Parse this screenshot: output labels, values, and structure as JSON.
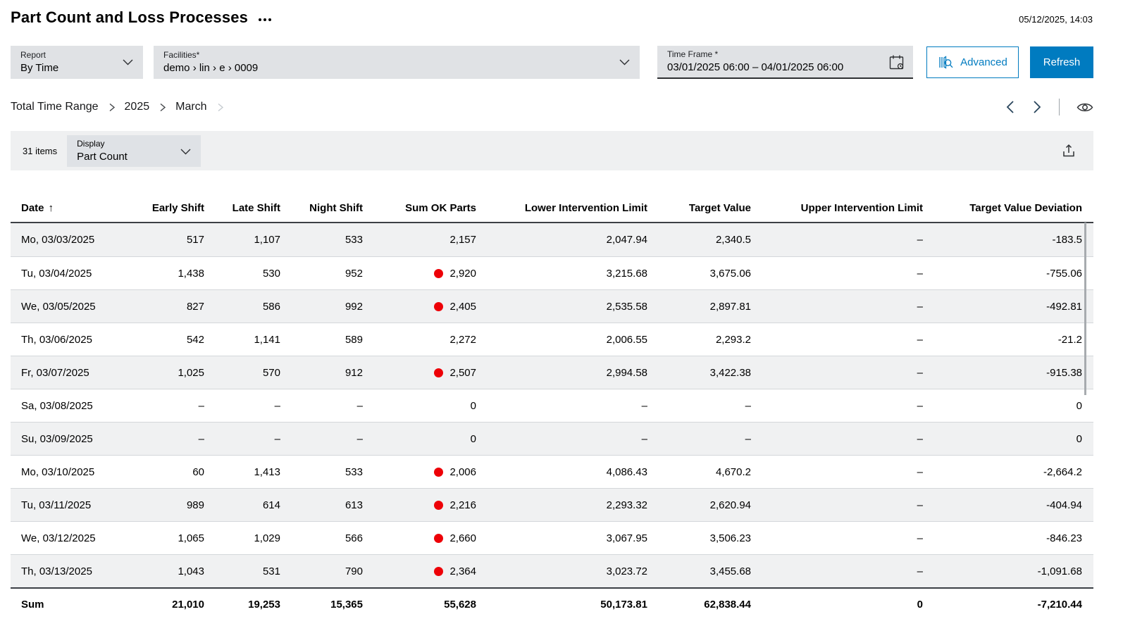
{
  "header": {
    "title": "Part Count and Loss Processes",
    "timestamp": "05/12/2025, 14:03"
  },
  "filters": {
    "report": {
      "label": "Report",
      "value": "By Time"
    },
    "facilities": {
      "label": "Facilities*",
      "value": "demo › lin › e › 0009"
    },
    "time_frame": {
      "label": "Time Frame *",
      "value": "03/01/2025 06:00 – 04/01/2025 06:00"
    },
    "advanced_label": "Advanced",
    "refresh_label": "Refresh"
  },
  "breadcrumb": {
    "items": [
      "Total Time Range",
      "2025",
      "March"
    ]
  },
  "toolbar": {
    "items_count": "31 items",
    "display": {
      "label": "Display",
      "value": "Part Count"
    }
  },
  "table": {
    "sort": {
      "column": "date",
      "indicator": "↑"
    },
    "columns": [
      {
        "key": "date",
        "label": "Date"
      },
      {
        "key": "early_shift",
        "label": "Early Shift"
      },
      {
        "key": "late_shift",
        "label": "Late Shift"
      },
      {
        "key": "night_shift",
        "label": "Night Shift"
      },
      {
        "key": "sum_ok_parts",
        "label": "Sum OK Parts"
      },
      {
        "key": "lower_limit",
        "label": "Lower Intervention Limit"
      },
      {
        "key": "target_value",
        "label": "Target Value"
      },
      {
        "key": "upper_limit",
        "label": "Upper Intervention Limit"
      },
      {
        "key": "deviation",
        "label": "Target Value Deviation"
      }
    ],
    "rows": [
      {
        "date": "Mo, 03/03/2025",
        "early_shift": "517",
        "late_shift": "1,107",
        "night_shift": "533",
        "sum_ok_parts": "2,157",
        "alert": false,
        "lower_limit": "2,047.94",
        "target_value": "2,340.5",
        "upper_limit": "–",
        "deviation": "-183.5"
      },
      {
        "date": "Tu, 03/04/2025",
        "early_shift": "1,438",
        "late_shift": "530",
        "night_shift": "952",
        "sum_ok_parts": "2,920",
        "alert": true,
        "lower_limit": "3,215.68",
        "target_value": "3,675.06",
        "upper_limit": "–",
        "deviation": "-755.06"
      },
      {
        "date": "We, 03/05/2025",
        "early_shift": "827",
        "late_shift": "586",
        "night_shift": "992",
        "sum_ok_parts": "2,405",
        "alert": true,
        "lower_limit": "2,535.58",
        "target_value": "2,897.81",
        "upper_limit": "–",
        "deviation": "-492.81"
      },
      {
        "date": "Th, 03/06/2025",
        "early_shift": "542",
        "late_shift": "1,141",
        "night_shift": "589",
        "sum_ok_parts": "2,272",
        "alert": false,
        "lower_limit": "2,006.55",
        "target_value": "2,293.2",
        "upper_limit": "–",
        "deviation": "-21.2"
      },
      {
        "date": "Fr, 03/07/2025",
        "early_shift": "1,025",
        "late_shift": "570",
        "night_shift": "912",
        "sum_ok_parts": "2,507",
        "alert": true,
        "lower_limit": "2,994.58",
        "target_value": "3,422.38",
        "upper_limit": "–",
        "deviation": "-915.38"
      },
      {
        "date": "Sa, 03/08/2025",
        "early_shift": "–",
        "late_shift": "–",
        "night_shift": "–",
        "sum_ok_parts": "0",
        "alert": false,
        "lower_limit": "–",
        "target_value": "–",
        "upper_limit": "–",
        "deviation": "0"
      },
      {
        "date": "Su, 03/09/2025",
        "early_shift": "–",
        "late_shift": "–",
        "night_shift": "–",
        "sum_ok_parts": "0",
        "alert": false,
        "lower_limit": "–",
        "target_value": "–",
        "upper_limit": "–",
        "deviation": "0"
      },
      {
        "date": "Mo, 03/10/2025",
        "early_shift": "60",
        "late_shift": "1,413",
        "night_shift": "533",
        "sum_ok_parts": "2,006",
        "alert": true,
        "lower_limit": "4,086.43",
        "target_value": "4,670.2",
        "upper_limit": "–",
        "deviation": "-2,664.2"
      },
      {
        "date": "Tu, 03/11/2025",
        "early_shift": "989",
        "late_shift": "614",
        "night_shift": "613",
        "sum_ok_parts": "2,216",
        "alert": true,
        "lower_limit": "2,293.32",
        "target_value": "2,620.94",
        "upper_limit": "–",
        "deviation": "-404.94"
      },
      {
        "date": "We, 03/12/2025",
        "early_shift": "1,065",
        "late_shift": "1,029",
        "night_shift": "566",
        "sum_ok_parts": "2,660",
        "alert": true,
        "lower_limit": "3,067.95",
        "target_value": "3,506.23",
        "upper_limit": "–",
        "deviation": "-846.23"
      },
      {
        "date": "Th, 03/13/2025",
        "early_shift": "1,043",
        "late_shift": "531",
        "night_shift": "790",
        "sum_ok_parts": "2,364",
        "alert": true,
        "lower_limit": "3,023.72",
        "target_value": "3,455.68",
        "upper_limit": "–",
        "deviation": "-1,091.68"
      }
    ],
    "sum_row": {
      "date": "Sum",
      "early_shift": "21,010",
      "late_shift": "19,253",
      "night_shift": "15,365",
      "sum_ok_parts": "55,628",
      "alert": false,
      "lower_limit": "50,173.81",
      "target_value": "62,838.44",
      "upper_limit": "0",
      "deviation": "-7,210.44"
    }
  },
  "colors": {
    "accent": "#007bc0",
    "alert_dot": "#ed0007"
  }
}
